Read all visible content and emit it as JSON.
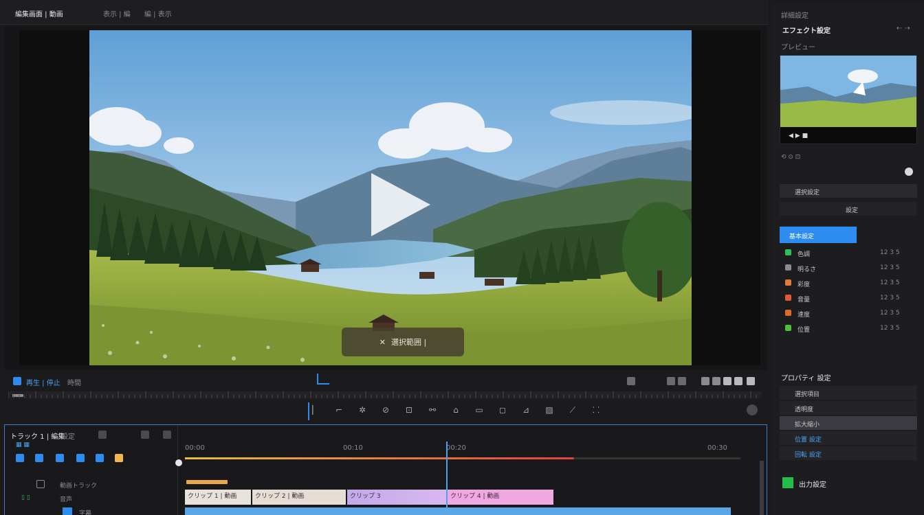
{
  "topbar": {
    "title": "編集画面 | 動画",
    "menu_a": "表示 | 編",
    "menu_b": "編 | 表示"
  },
  "viewer": {
    "caption_icon": "✕",
    "caption_text": "選択範囲 |",
    "play_icon": "play-icon"
  },
  "controls": {
    "label_left": "再生 | 停止",
    "label_mid": "時間",
    "timecode": ""
  },
  "tools": [
    {
      "name": "cursor-tool",
      "glyph": "▏"
    },
    {
      "name": "trim-tool",
      "glyph": "⌐"
    },
    {
      "name": "ripple-tool",
      "glyph": "✲"
    },
    {
      "name": "slip-tool",
      "glyph": "⊘"
    },
    {
      "name": "crop-tool",
      "glyph": "⊡"
    },
    {
      "name": "link-tool",
      "glyph": "⚯"
    },
    {
      "name": "shape-tool",
      "glyph": "⌂"
    },
    {
      "name": "marker-tool",
      "glyph": "▭"
    },
    {
      "name": "text-tool",
      "glyph": "◻"
    },
    {
      "name": "pen-tool",
      "glyph": "⊿"
    },
    {
      "name": "mask-tool",
      "glyph": "▨"
    },
    {
      "name": "blade-tool",
      "glyph": "⟋"
    },
    {
      "name": "hand-tool",
      "glyph": "⸬"
    }
  ],
  "timeline": {
    "header_title": "トラック 1 | 編集",
    "header_sub": "設定",
    "track_label_1": "動画トラック",
    "track_label_2": "音声",
    "track_label_3": "字幕",
    "ruler_marks": [
      "00:00",
      "00:10",
      "00:20",
      "00:30"
    ],
    "clips": [
      {
        "label": "クリップ 1 | 動画"
      },
      {
        "label": "クリップ 2 | 動画"
      },
      {
        "label": "クリップ 3"
      },
      {
        "label": "クリップ 4 | 動画"
      }
    ]
  },
  "rpanel": {
    "title": "詳細設定",
    "section_title": "エフェクト設定",
    "subtitle": "プレビュー",
    "preview_controls": "◀ ▶ ■",
    "row_input_label": "選択設定",
    "row_field_label": "設定",
    "row_selected": "基本設定",
    "list_items": [
      {
        "label": "色調",
        "value": "12 3 5",
        "color": "#2fbf5a"
      },
      {
        "label": "明るさ",
        "value": "12 3 5",
        "color": "#8a8a90"
      },
      {
        "label": "彩度",
        "value": "12 3 5",
        "color": "#e07b3a"
      },
      {
        "label": "音量",
        "value": "12 3 5",
        "color": "#e05a3a"
      },
      {
        "label": "速度",
        "value": "12 3 5",
        "color": "#e06a2a"
      },
      {
        "label": "位置",
        "value": "12 3 5",
        "color": "#4fbf3a"
      }
    ],
    "properties_title": "プロパティ 設定",
    "prop_rows": [
      "選択項目",
      "透明度",
      "拡大縮小",
      "位置 設定",
      "回転 設定"
    ],
    "export_label": "出力設定"
  },
  "colors": {
    "accent": "#2d8cf0",
    "timeline_border": "#3a7fd0",
    "playhead": "#e84040",
    "audio_track": "#5aa7e8"
  }
}
